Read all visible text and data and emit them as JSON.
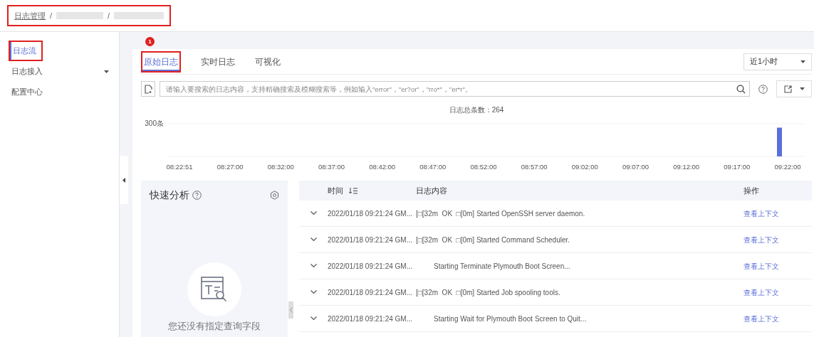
{
  "breadcrumb": {
    "items": [
      "日志管理",
      "/",
      "/"
    ]
  },
  "sidebar": {
    "items": [
      {
        "label": "日志流",
        "selected": true,
        "has_caret": false
      },
      {
        "label": "日志接入",
        "selected": false,
        "has_caret": true
      },
      {
        "label": "配置中心",
        "selected": false,
        "has_caret": false
      }
    ]
  },
  "annotation_badge": "1",
  "tabs": [
    {
      "label": "原始日志",
      "selected": true
    },
    {
      "label": "实时日志",
      "selected": false
    },
    {
      "label": "可视化",
      "selected": false
    }
  ],
  "time_range": {
    "value": "近1小时"
  },
  "search": {
    "placeholder": "请输入要搜索的日志内容，支持精确搜索及模糊搜索等，例如输入\"error\"，\"er?or\"，\"rro*\"，\"er*r\"。"
  },
  "total": "日志总条数：264",
  "chart": {
    "y_label": "300条",
    "x_labels": [
      "08:22:51",
      "08:27:00",
      "08:32:00",
      "08:37:00",
      "08:42:00",
      "08:47:00",
      "08:52:00",
      "08:57:00",
      "09:02:00",
      "09:07:00",
      "09:12:00",
      "09:17:00",
      "09:22:00"
    ]
  },
  "quick_analysis": {
    "title": "快速分析",
    "empty_text": "您还没有指定查询字段"
  },
  "table": {
    "columns": [
      "时间",
      "日志内容",
      "操作"
    ],
    "rows": [
      {
        "time": "2022/01/18 09:21:24 GM...",
        "content": "[□[32m  OK  □[0m] Started OpenSSH server daemon.",
        "action": "查看上下文"
      },
      {
        "time": "2022/01/18 09:21:24 GM...",
        "content": "[□[32m  OK  □[0m] Started Command Scheduler.",
        "action": "查看上下文"
      },
      {
        "time": "2022/01/18 09:21:24 GM...",
        "content": "         Starting Terminate Plymouth Boot Screen...",
        "action": "查看上下文"
      },
      {
        "time": "2022/01/18 09:21:24 GM...",
        "content": "[□[32m  OK  □[0m] Started Job spooling tools.",
        "action": "查看上下文"
      },
      {
        "time": "2022/01/18 09:21:24 GM...",
        "content": "         Starting Wait for Plymouth Boot Screen to Quit...",
        "action": "查看上下文"
      }
    ]
  }
}
